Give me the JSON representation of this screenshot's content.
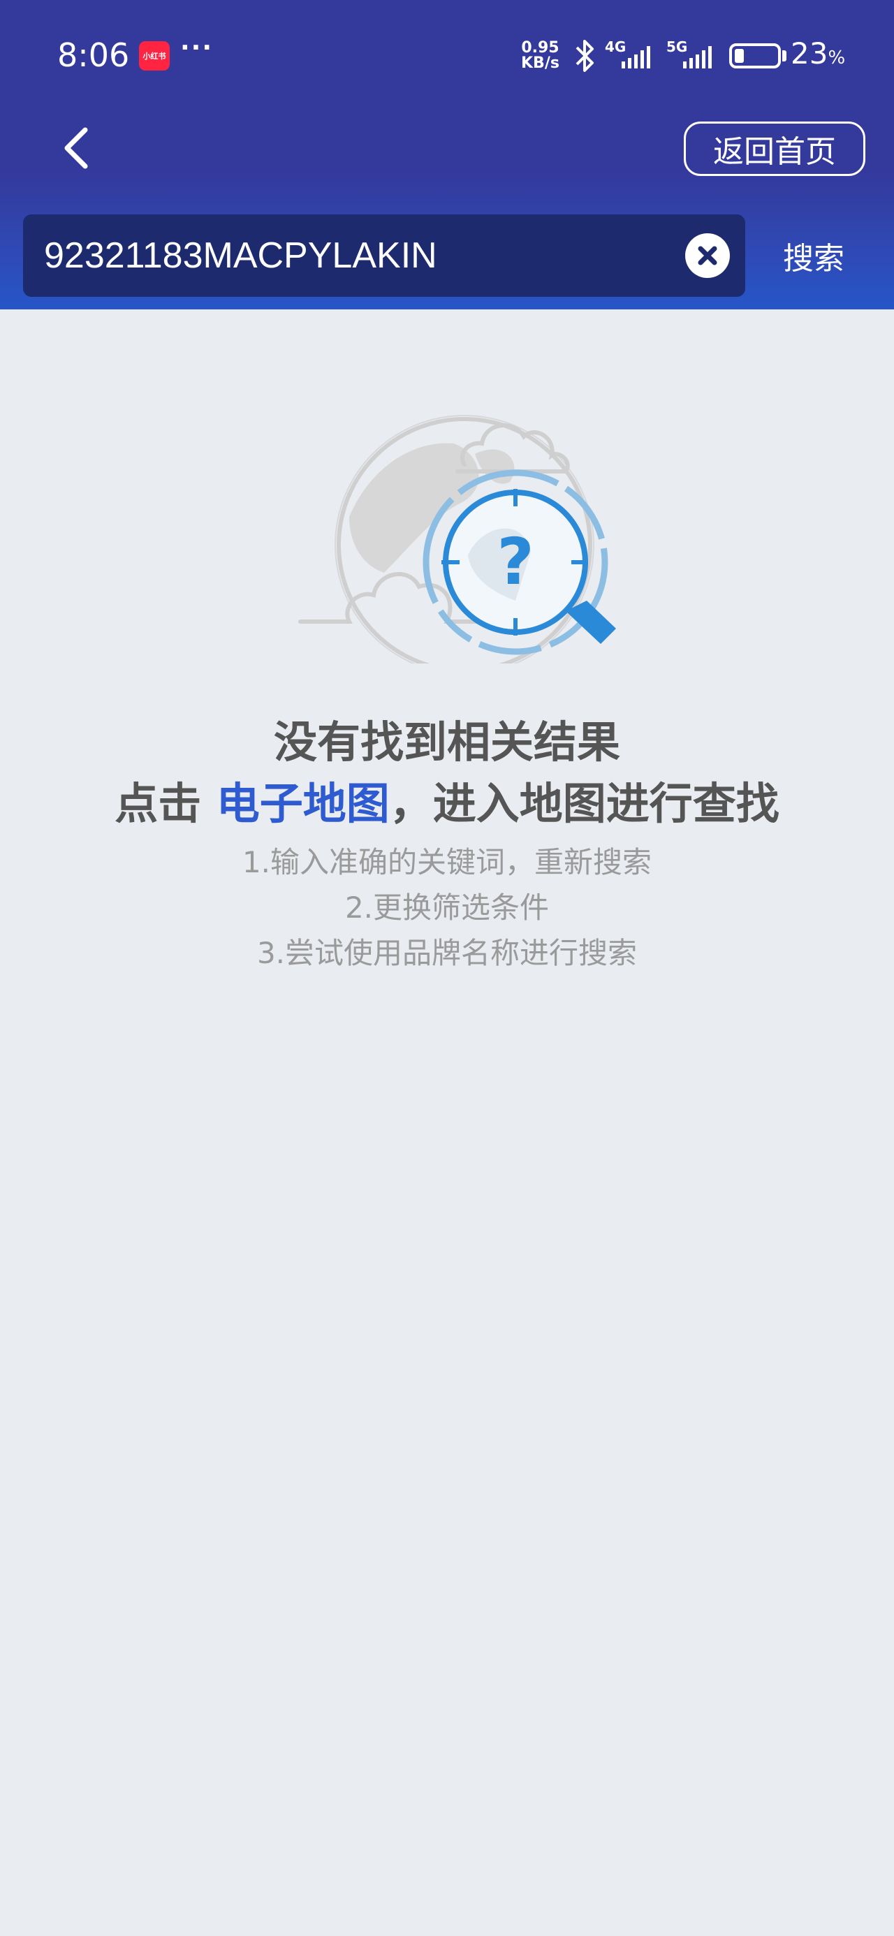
{
  "status_bar": {
    "time": "8:06",
    "app_badge": "小红书",
    "more": "···",
    "net_speed_value": "0.95",
    "net_speed_unit": "KB/s",
    "signal_1": "4G",
    "signal_2": "5G",
    "battery_percent": "23",
    "battery_unit": "%",
    "battery_level": 0.23
  },
  "header": {
    "back_icon": "chevron-left-icon",
    "home_button": "返回首页"
  },
  "search": {
    "query": "92321183MACPYLAKIN",
    "clear_icon": "close-circle-icon",
    "button": "搜索"
  },
  "empty_state": {
    "illustration": "globe-magnifier-question-icon",
    "title": "没有找到相关结果",
    "hint_prefix": "点击 ",
    "hint_link": "电子地图",
    "hint_suffix": "，进入地图进行查找",
    "tips": [
      "1.输入准确的关键词，重新搜索",
      "2.更换筛选条件",
      "3.尝试使用品牌名称进行搜索"
    ]
  },
  "colors": {
    "header": "#34399c",
    "search_box": "#1e2a6e",
    "link": "#2f5bd1",
    "background": "#e9ecf1",
    "accent": "#2a8ad8"
  }
}
